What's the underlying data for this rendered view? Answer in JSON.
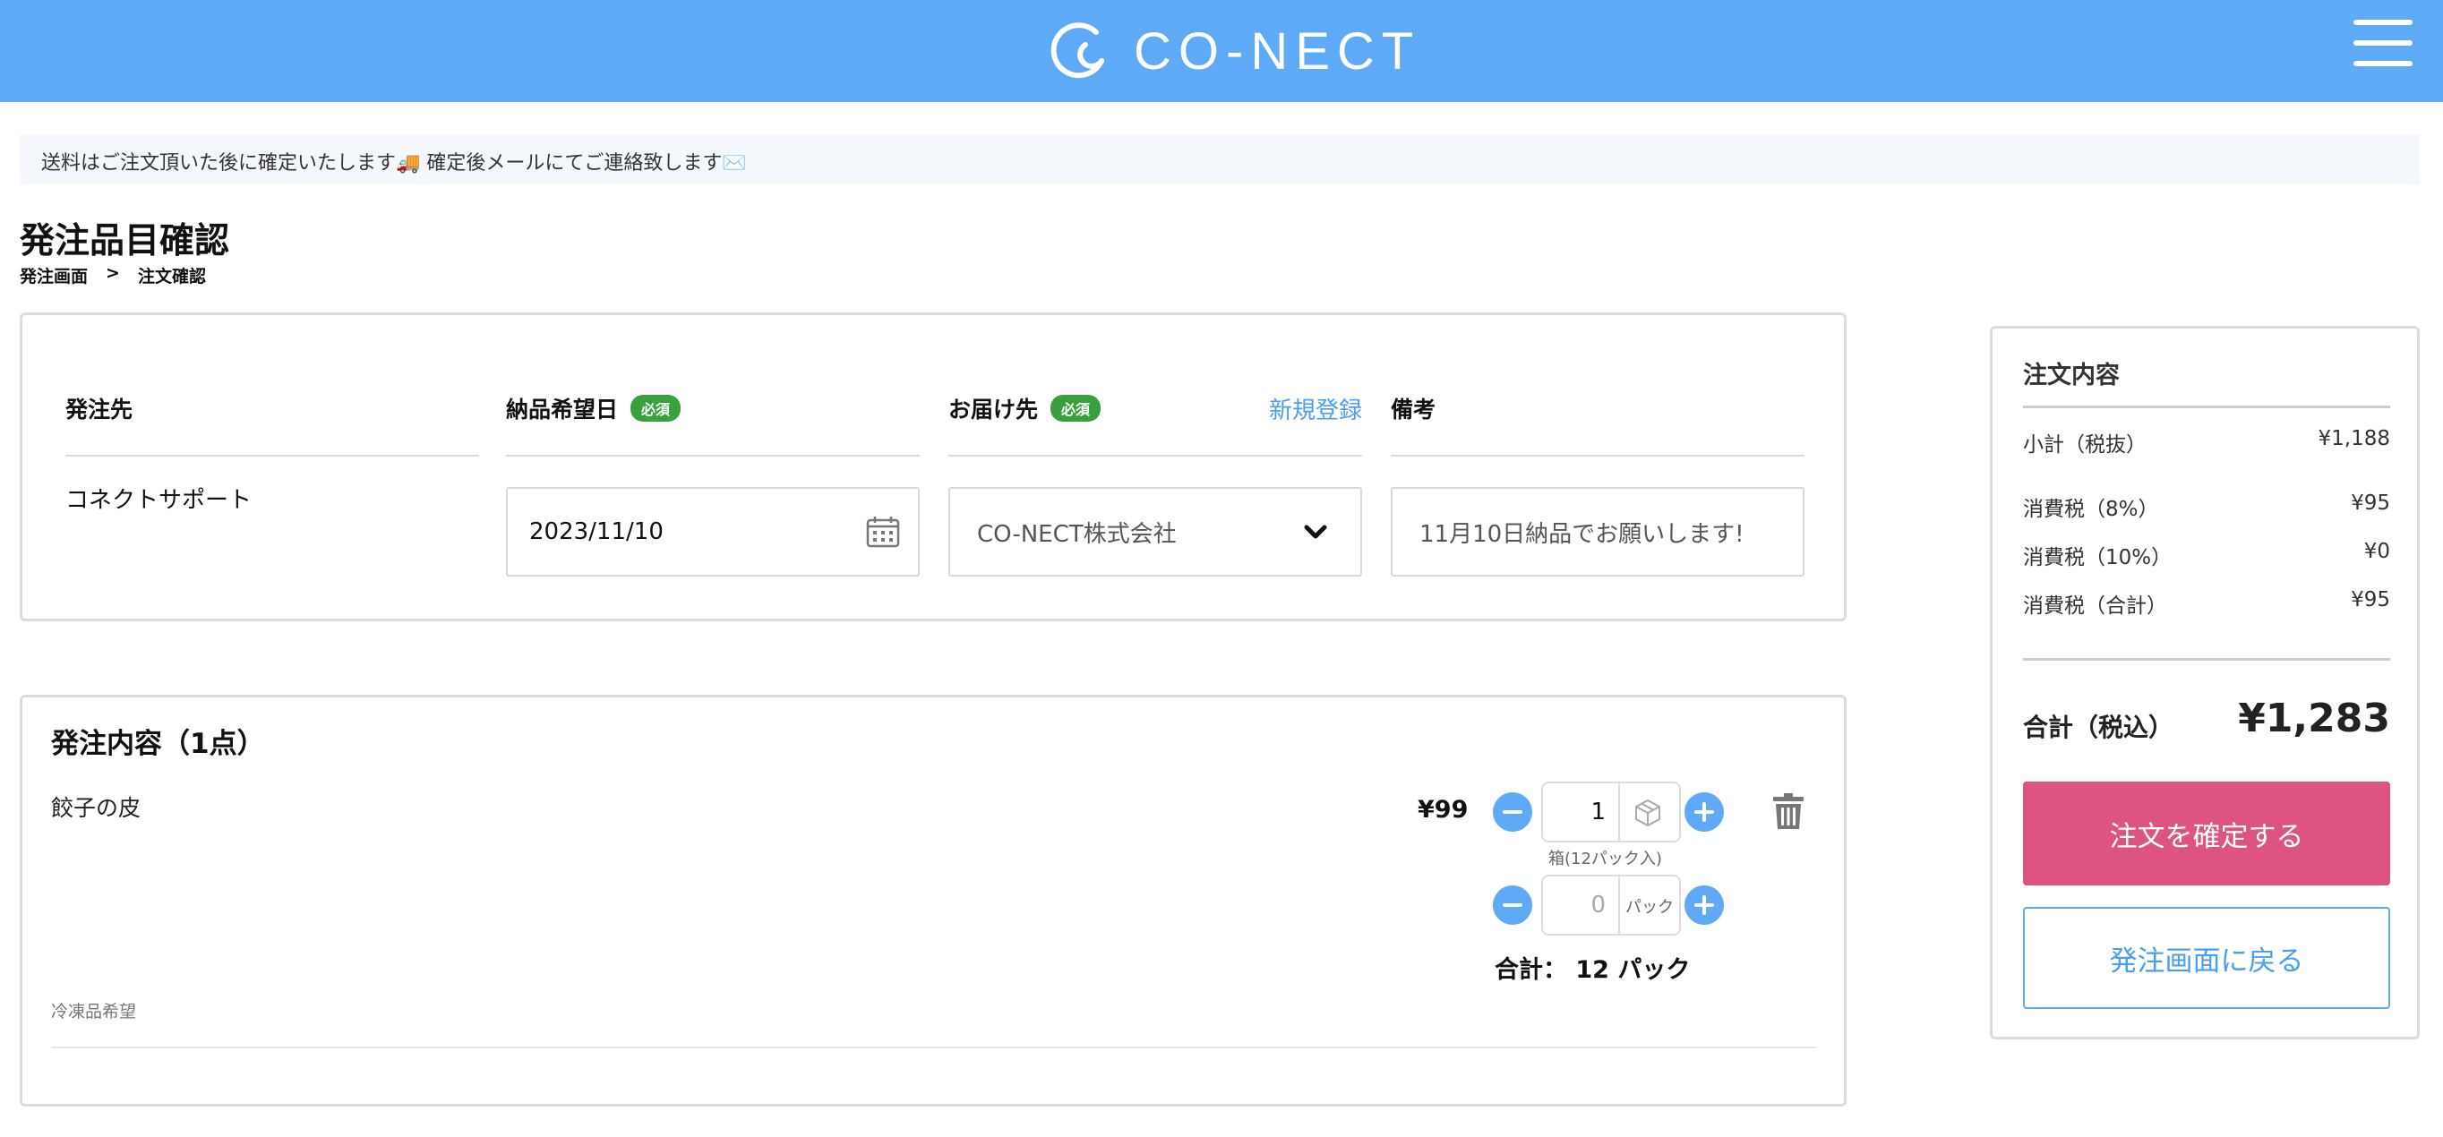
{
  "header": {
    "brand": "CO-NECT",
    "logo_icon": "conect-logo-icon",
    "menu_icon": "hamburger-menu-icon",
    "background_color": "#5eaaf6"
  },
  "notice": {
    "text": "送料はご注文頂いた後に確定いたします🚚 確定後メールにてご連絡致します✉️"
  },
  "page": {
    "title": "発注品目確認",
    "breadcrumb": [
      {
        "label": "発注画面"
      },
      {
        "label": "注文確認"
      }
    ],
    "breadcrumb_separator": ">"
  },
  "order_form": {
    "supplier": {
      "label": "発注先",
      "value": "コネクトサポート"
    },
    "delivery_date": {
      "label": "納品希望日",
      "required_badge": "必須",
      "value": "2023/11/10",
      "icon": "calendar-icon"
    },
    "destination": {
      "label": "お届け先",
      "required_badge": "必須",
      "new_link": "新規登録",
      "value": "CO-NECT株式会社",
      "icon": "chevron-down-icon"
    },
    "remarks": {
      "label": "備考",
      "value": "11月10日納品でお願いします!"
    }
  },
  "items": {
    "title": "発注内容（1点）",
    "list": [
      {
        "name": "餃子の皮",
        "note": "冷凍品希望",
        "price": "¥99",
        "box_qty": "1",
        "box_icon": "box-icon",
        "box_unit_caption": "箱(12パック入)",
        "pack_qty": "0",
        "pack_unit": "パック",
        "total": "合計： 12 パック",
        "delete_icon": "trash-icon"
      }
    ]
  },
  "summary": {
    "title": "注文内容",
    "subtotal": {
      "label": "小計（税抜）",
      "value": "¥1,188"
    },
    "tax8": {
      "label": "消費税（8%）",
      "value": "¥95"
    },
    "tax10": {
      "label": "消費税（10%）",
      "value": "¥0"
    },
    "tax_total": {
      "label": "消費税（合計）",
      "value": "¥95"
    },
    "total": {
      "label": "合計（税込）",
      "value": "¥1,283"
    },
    "confirm_button": "注文を確定する",
    "back_button": "発注画面に戻る",
    "confirm_color": "#dd5480",
    "accent_color": "#4a9eef"
  }
}
